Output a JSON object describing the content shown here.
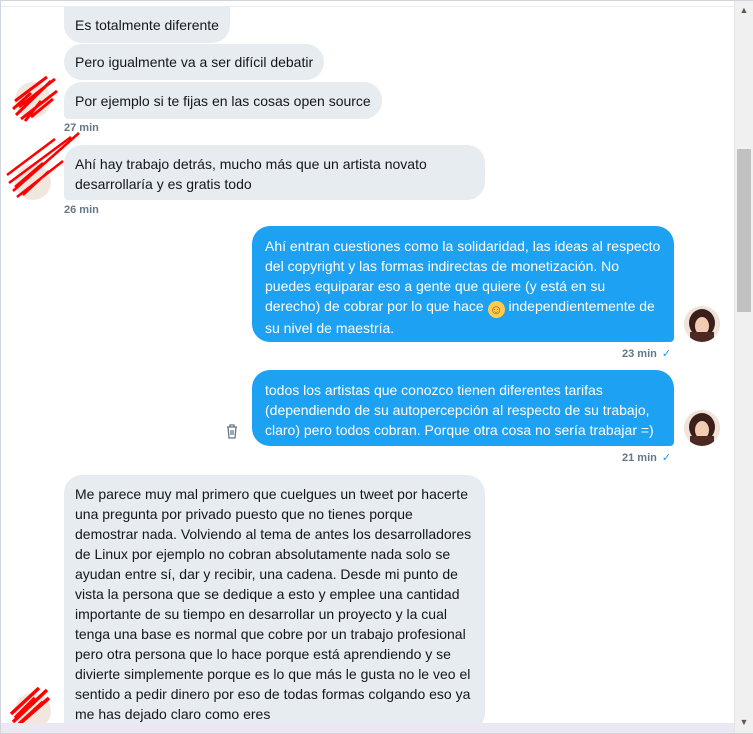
{
  "conversation": {
    "messages": [
      {
        "side": "received",
        "text": "Es totalmente diferente"
      },
      {
        "side": "received",
        "text": "Pero igualmente va a ser difícil debatir"
      },
      {
        "side": "received",
        "text": "Por ejemplo si te fijas en las cosas open source"
      },
      {
        "side": "received",
        "text": "Ahí hay trabajo detrás, mucho más que un artista novato desarrollaría y es gratis todo"
      },
      {
        "side": "sent",
        "text_before": "Ahí entran cuestiones como la solidaridad, las ideas al respecto del copyright y las formas indirectas de monetización. No puedes equiparar eso a gente que quiere (y está en su derecho) de cobrar por lo que hace ",
        "emoji": "☺",
        "text_after": " independientemente de su nivel de maestría."
      },
      {
        "side": "sent",
        "text": "todos los artistas que conozco tienen diferentes tarifas (dependiendo de su autopercepción al respecto de su trabajo, claro) pero todos cobran. Porque otra cosa no sería trabajar =)"
      },
      {
        "side": "received",
        "text": "Me parece muy mal primero que cuelgues un tweet por hacerte una pregunta por privado puesto que no tienes porque demostrar nada. Volviendo al tema de antes los desarrolladores de Linux por ejemplo no cobran absolutamente nada solo se ayudan entre sí, dar y recibir, una cadena. Desde mi punto de vista la persona que se dedique a esto y emplee una cantidad importante de su tiempo en desarrollar un proyecto y la cual tenga una base es normal que cobre por un trabajo profesional pero otra persona que lo hace porque está aprendiendo y se divierte simplemente porque es lo que más le gusta no le veo el sentido a pedir dinero por eso de todas formas colgando eso ya me has dejado claro como eres"
      }
    ],
    "timestamps": [
      "27 min",
      "26 min",
      "23 min",
      "21 min"
    ],
    "checkmark": "✓"
  },
  "icons": {
    "delete": "trash-icon",
    "read_receipt": "check-icon",
    "scroll_up": "▲",
    "scroll_down": "▼"
  },
  "colors": {
    "sent_bubble": "#1da1f2",
    "received_bubble": "#e6ecf0",
    "timestamp": "#657786",
    "redaction": "#ff0000"
  }
}
